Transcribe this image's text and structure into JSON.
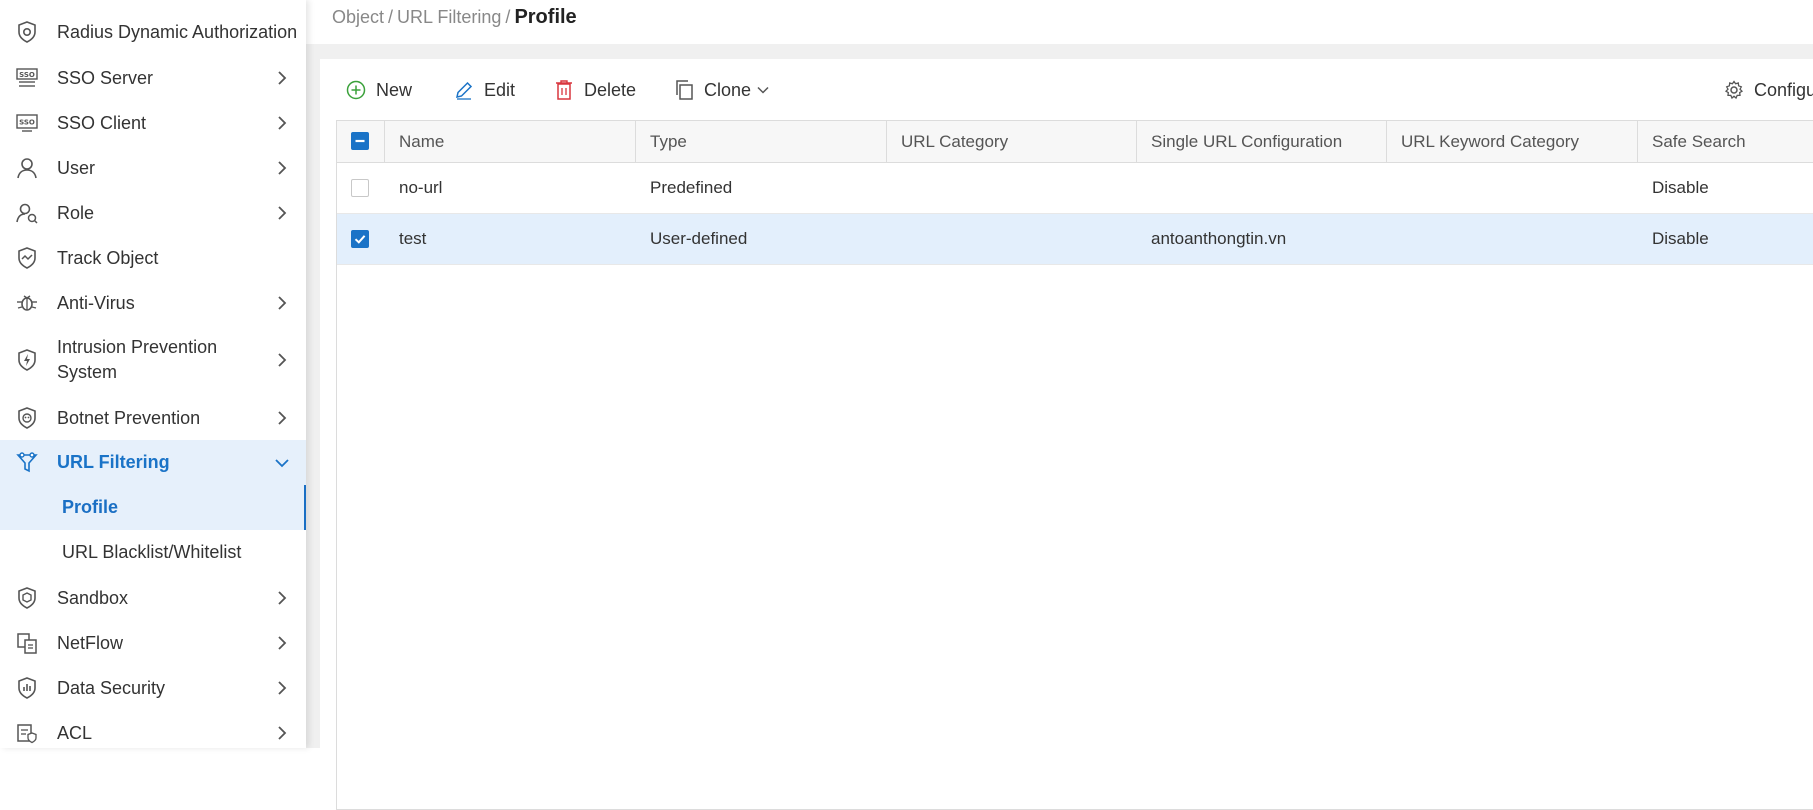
{
  "sidebar": {
    "items": [
      {
        "label": "Radius Dynamic Authorization",
        "icon": "shield-circle-icon",
        "has_children": false
      },
      {
        "label": "SSO Server",
        "icon": "sso-server-icon",
        "has_children": true
      },
      {
        "label": "SSO Client",
        "icon": "sso-client-icon",
        "has_children": true
      },
      {
        "label": "User",
        "icon": "user-icon",
        "has_children": true
      },
      {
        "label": "Role",
        "icon": "role-icon",
        "has_children": true
      },
      {
        "label": "Track Object",
        "icon": "track-object-icon",
        "has_children": false
      },
      {
        "label": "Anti-Virus",
        "icon": "virus-icon",
        "has_children": true
      },
      {
        "label": "Intrusion Prevention",
        "label_line2": "System",
        "icon": "ips-shield-icon",
        "has_children": true
      },
      {
        "label": "Botnet Prevention",
        "icon": "botnet-icon",
        "has_children": true
      },
      {
        "label": "URL Filtering",
        "icon": "url-filter-icon",
        "has_children": true,
        "expanded": true,
        "active": true
      },
      {
        "label": "Profile",
        "sub": true,
        "active": true
      },
      {
        "label": "URL Blacklist/Whitelist",
        "sub": true
      },
      {
        "label": "Sandbox",
        "icon": "sandbox-icon",
        "has_children": true
      },
      {
        "label": "NetFlow",
        "icon": "netflow-icon",
        "has_children": true
      },
      {
        "label": "Data Security",
        "icon": "data-security-icon",
        "has_children": true
      },
      {
        "label": "ACL",
        "icon": "acl-icon",
        "has_children": true
      }
    ]
  },
  "breadcrumb": {
    "items": [
      "Object",
      "URL Filtering"
    ],
    "separator": "/",
    "current": "Profile"
  },
  "toolbar": {
    "new_label": "New",
    "edit_label": "Edit",
    "delete_label": "Delete",
    "clone_label": "Clone",
    "configure_label": "Configu"
  },
  "table": {
    "columns": [
      "Name",
      "Type",
      "URL Category",
      "Single URL Configuration",
      "URL Keyword Category",
      "Safe Search"
    ],
    "header_checkbox": "indeterminate",
    "rows": [
      {
        "selected": false,
        "cells": [
          "no-url",
          "Predefined",
          "",
          "",
          "",
          "Disable"
        ]
      },
      {
        "selected": true,
        "cells": [
          "test",
          "User-defined",
          "",
          "antoanthongtin.vn",
          "",
          "Disable"
        ]
      }
    ]
  },
  "colors": {
    "accent": "#1a73c7",
    "selected_row": "#e3effc",
    "new_icon": "#3aa13a",
    "delete_icon": "#d9363e"
  }
}
